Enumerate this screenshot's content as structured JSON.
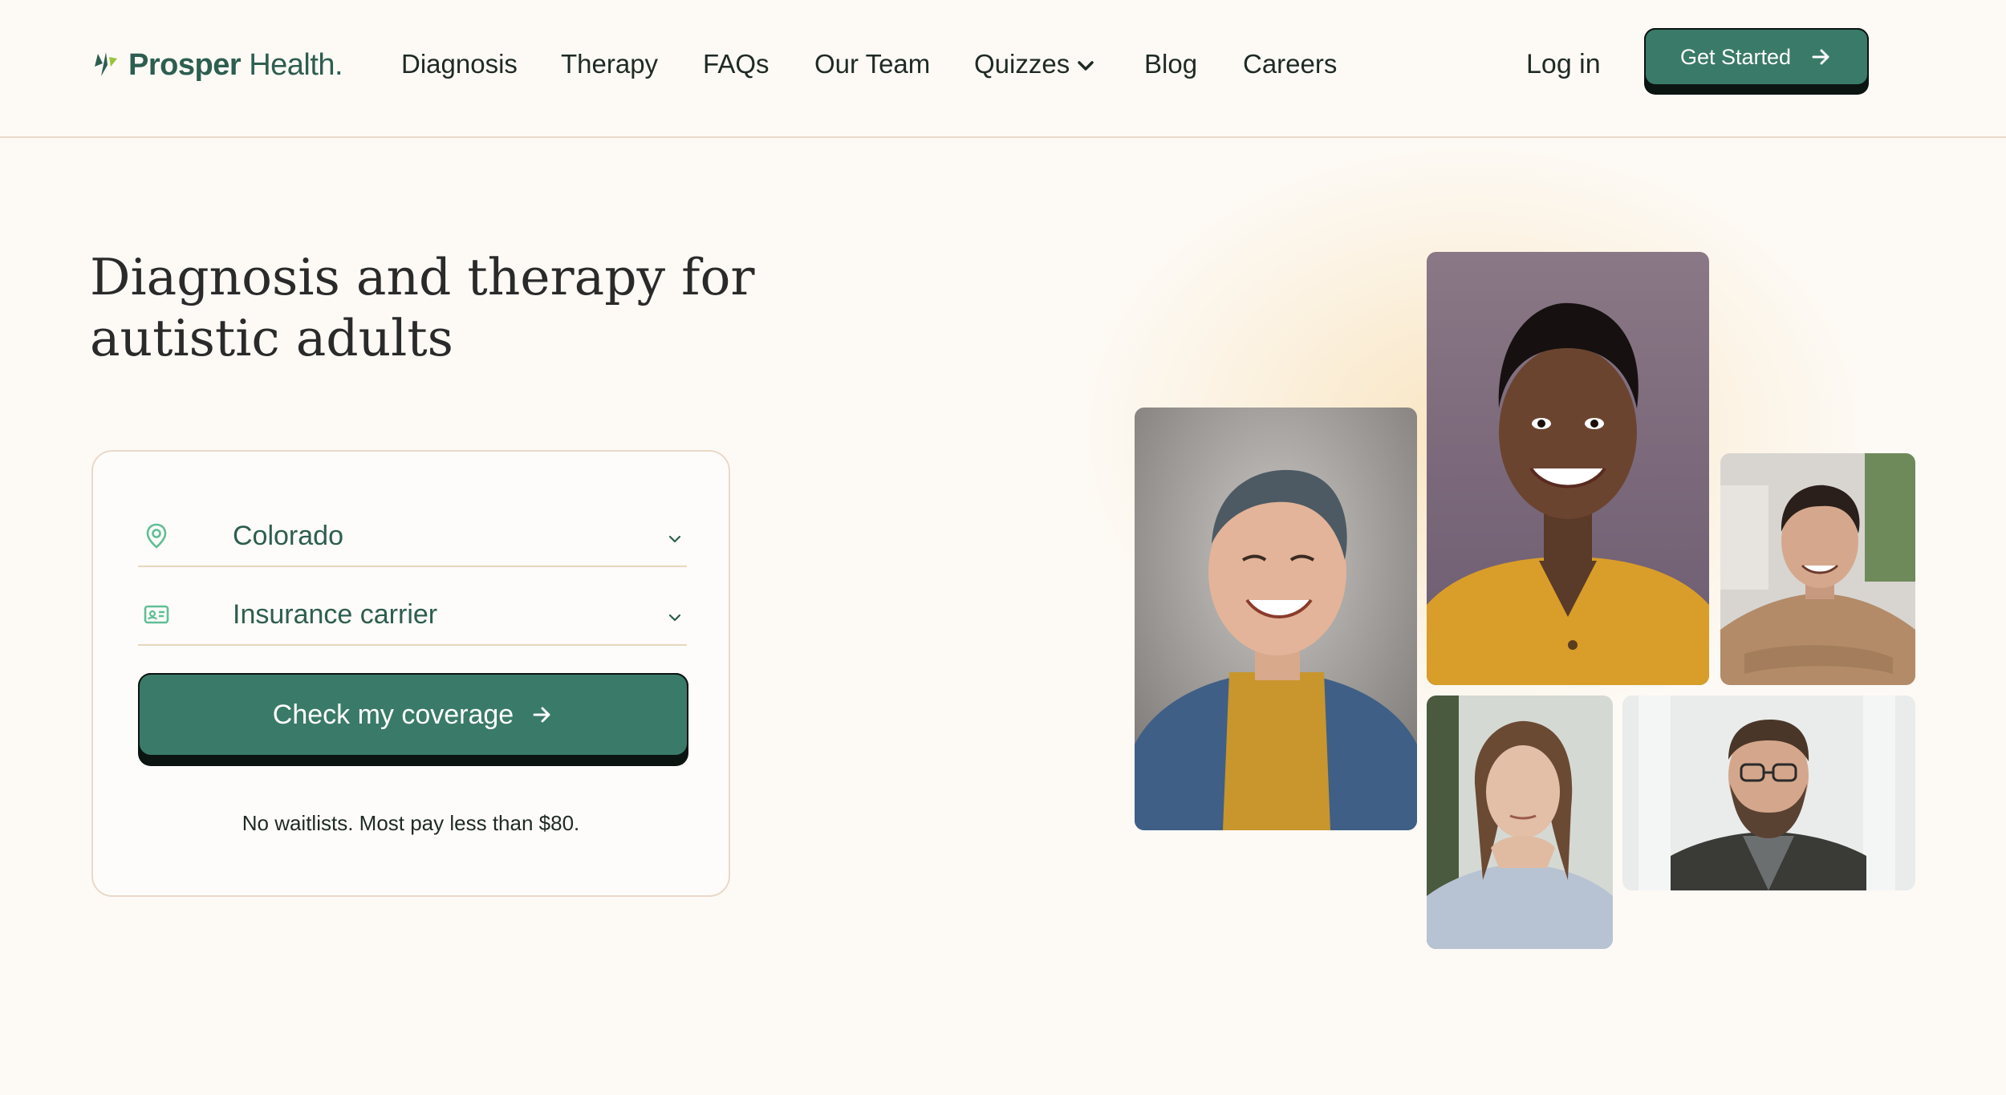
{
  "brand": {
    "name_bold": "Prosper",
    "name_light": "Health."
  },
  "nav": {
    "items": [
      "Diagnosis",
      "Therapy",
      "FAQs",
      "Our Team",
      "Quizzes",
      "Blog",
      "Careers"
    ],
    "login_label": "Log in",
    "cta_label": "Get Started"
  },
  "hero": {
    "title": "Diagnosis and therapy for autistic adults"
  },
  "coverage_form": {
    "state_value": "Colorado",
    "insurance_placeholder": "Insurance carrier",
    "submit_label": "Check my coverage",
    "note": "No waitlists. Most pay less than $80."
  },
  "icons": {
    "logo": "prosper-leaf-icon",
    "dropdown": "chevron-down-icon",
    "arrow": "arrow-right-icon",
    "location": "location-pin-icon",
    "insurance": "id-card-icon"
  },
  "colors": {
    "brand_green": "#3a7a68",
    "text_green": "#2d5e50",
    "background": "#fdfaf6",
    "border": "#ead8c8"
  },
  "photos": [
    {
      "label": "laughing person in denim jacket and mustard sweater"
    },
    {
      "label": "smiling woman in mustard blouse"
    },
    {
      "label": "smiling young man in tan sweater"
    },
    {
      "label": "thoughtful woman resting chin on hands"
    },
    {
      "label": "bearded man with glasses and backpack"
    }
  ]
}
